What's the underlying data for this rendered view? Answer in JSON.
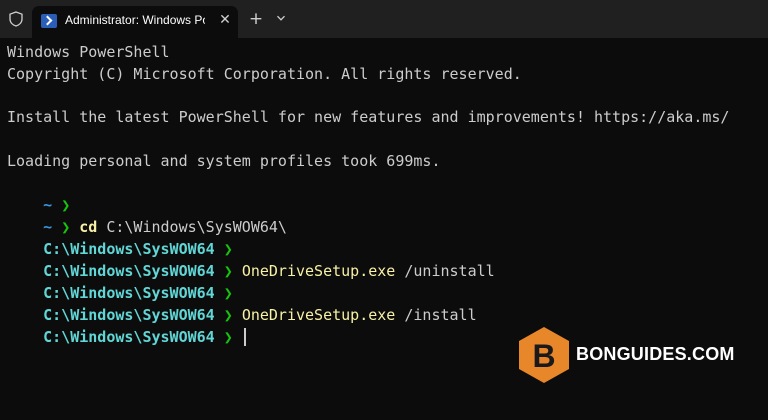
{
  "window": {
    "tab_title": "Administrator: Windows PowerShell",
    "tab_close_glyph": "✕",
    "new_tab_glyph": "+",
    "dropdown_glyph": "⌄",
    "icons": [
      "shield-icon",
      "powershell-icon",
      "close-icon",
      "plus-icon",
      "chevron-down-icon"
    ]
  },
  "terminal": {
    "header_line_1": "Windows PowerShell",
    "header_line_2": "Copyright (C) Microsoft Corporation. All rights reserved.",
    "install_message": "Install the latest PowerShell for new features and improvements! https://aka.ms/",
    "profile_message": "Loading personal and system profiles took 699ms.",
    "prompt_home": "~",
    "prompt_arrow": "❯",
    "commands": [
      {
        "prompt": "~",
        "cmd": "cd",
        "args": " C:\\Windows\\SysWOW64\\"
      },
      {
        "prompt": "C:\\Windows\\SysWOW64",
        "cmd": "",
        "args": ""
      },
      {
        "prompt": "C:\\Windows\\SysWOW64",
        "cmd": "OneDriveSetup.exe",
        "args": " /uninstall"
      },
      {
        "prompt": "C:\\Windows\\SysWOW64",
        "cmd": "",
        "args": ""
      },
      {
        "prompt": "C:\\Windows\\SysWOW64",
        "cmd": "OneDriveSetup.exe",
        "args": " /install"
      },
      {
        "prompt": "C:\\Windows\\SysWOW64",
        "cmd": "",
        "args": ""
      }
    ]
  },
  "colors": {
    "background": "#0c0c0c",
    "titlebar": "#202020",
    "prompt_path": "#61d6d6",
    "prompt_arrow": "#16c60c",
    "command": "#f9f1a5",
    "text": "#cccccc",
    "watermark_orange": "#e8862a"
  },
  "watermark": {
    "letter": "B",
    "text": "BONGUIDES.COM"
  }
}
